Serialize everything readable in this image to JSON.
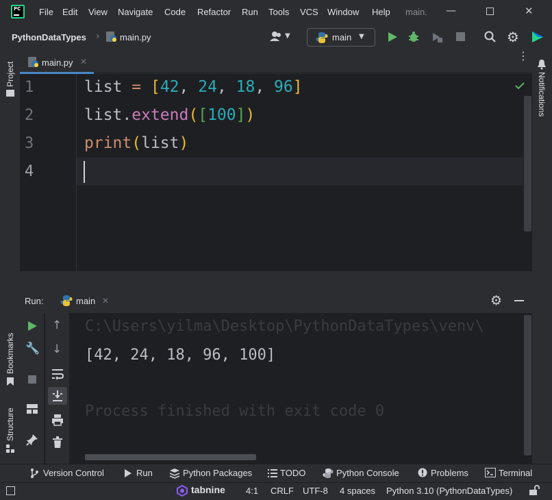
{
  "menu": {
    "items": [
      "File",
      "Edit",
      "View",
      "Navigate",
      "Code",
      "Refactor",
      "Run",
      "Tools",
      "VCS",
      "Window",
      "Help"
    ],
    "window_title": "main."
  },
  "nav": {
    "project": "PythonDataTypes",
    "file": "main.py",
    "run_config": "main"
  },
  "sidebar": {
    "project_label": "Project",
    "bookmarks_label": "Bookmarks",
    "structure_label": "Structure",
    "notifications_label": "Notifications"
  },
  "editor": {
    "tab_label": "main.py",
    "line_numbers": [
      "1",
      "2",
      "3",
      "4"
    ]
  },
  "run": {
    "label": "Run:",
    "tab_label": "main",
    "path_line": "C:\\Users\\yilma\\Desktop\\PythonDataTypes\\venv\\",
    "output_line": "[42, 24, 18, 96, 100]",
    "exit_line": "Process finished with exit code 0"
  },
  "bottom_tools": [
    "Version Control",
    "Run",
    "Python Packages",
    "TODO",
    "Python Console",
    "Problems",
    "Terminal"
  ],
  "status": {
    "plugin": "tabnine",
    "position": "4:1",
    "line_sep": "CRLF",
    "encoding": "UTF-8",
    "indent": "4 spaces",
    "interpreter": "Python 3.10 (PythonDataTypes)"
  },
  "colors": {
    "accent": "#4a88c7",
    "run_green": "#5fb865",
    "keyword_orange": "#cf8e6d",
    "number_blue": "#2aacb8",
    "method_purple": "#c77dbb",
    "bracket_gold": "#e8ba36"
  }
}
